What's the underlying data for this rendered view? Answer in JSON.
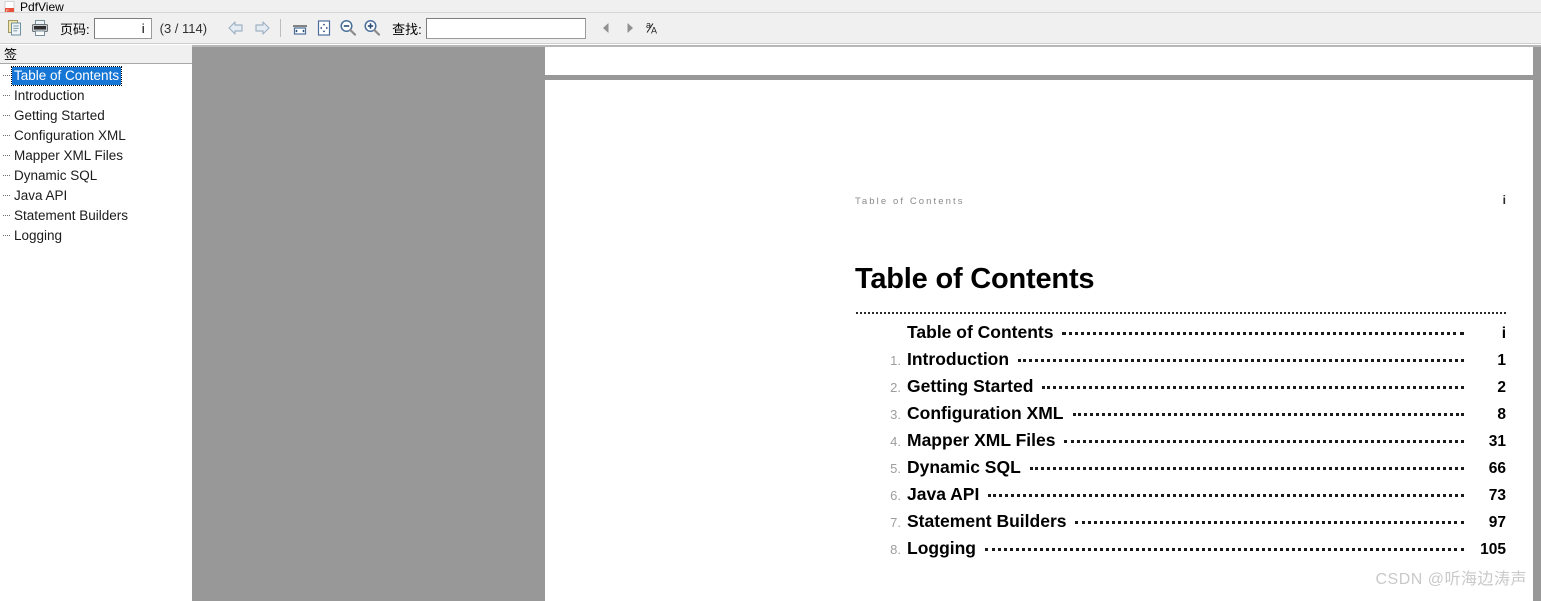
{
  "window": {
    "title": "PdfView",
    "app_icon": "pdf-file-icon"
  },
  "toolbar": {
    "copy_icon": "copy-document-icon",
    "print_icon": "printer-icon",
    "page_label": "页码:",
    "page_value": "i",
    "page_total": "(3 / 114)",
    "back_icon": "arrow-back-icon",
    "forward_icon": "arrow-forward-icon",
    "fit_width_icon": "fit-width-icon",
    "fit_page_icon": "fit-page-icon",
    "zoom_out_icon": "zoom-out-icon",
    "zoom_in_icon": "zoom-in-icon",
    "find_label": "查找:",
    "find_value": "",
    "find_placeholder": "",
    "find_prev_icon": "find-previous-icon",
    "find_next_icon": "find-next-icon",
    "match_case_icon": "match-case-icon"
  },
  "sidebar": {
    "tab_label": "签",
    "bookmarks": [
      {
        "label": "Table of Contents",
        "selected": true
      },
      {
        "label": "Introduction",
        "selected": false
      },
      {
        "label": "Getting Started",
        "selected": false
      },
      {
        "label": "Configuration XML",
        "selected": false
      },
      {
        "label": "Mapper XML Files",
        "selected": false
      },
      {
        "label": "Dynamic SQL",
        "selected": false
      },
      {
        "label": "Java API",
        "selected": false
      },
      {
        "label": "Statement Builders",
        "selected": false
      },
      {
        "label": "Logging",
        "selected": false
      }
    ]
  },
  "document": {
    "running_header": "Table of Contents",
    "header_page_number": "i",
    "heading": "Table of Contents",
    "toc": [
      {
        "num": "",
        "name": "Table of Contents",
        "page": "i"
      },
      {
        "num": "1.",
        "name": "Introduction",
        "page": "1"
      },
      {
        "num": "2.",
        "name": "Getting Started",
        "page": "2"
      },
      {
        "num": "3.",
        "name": "Configuration XML",
        "page": "8"
      },
      {
        "num": "4.",
        "name": "Mapper XML Files",
        "page": "31"
      },
      {
        "num": "5.",
        "name": "Dynamic SQL",
        "page": "66"
      },
      {
        "num": "6.",
        "name": "Java API",
        "page": "73"
      },
      {
        "num": "7.",
        "name": "Statement Builders",
        "page": "97"
      },
      {
        "num": "8.",
        "name": "Logging",
        "page": "105"
      }
    ]
  },
  "watermark": {
    "text": "CSDN @听海边涛声"
  },
  "colors": {
    "selection_blue": "#1576d6",
    "chrome_grey": "#f0f0f0",
    "page_backdrop_grey": "#989898",
    "watermark_grey": "#c9c9c9"
  }
}
